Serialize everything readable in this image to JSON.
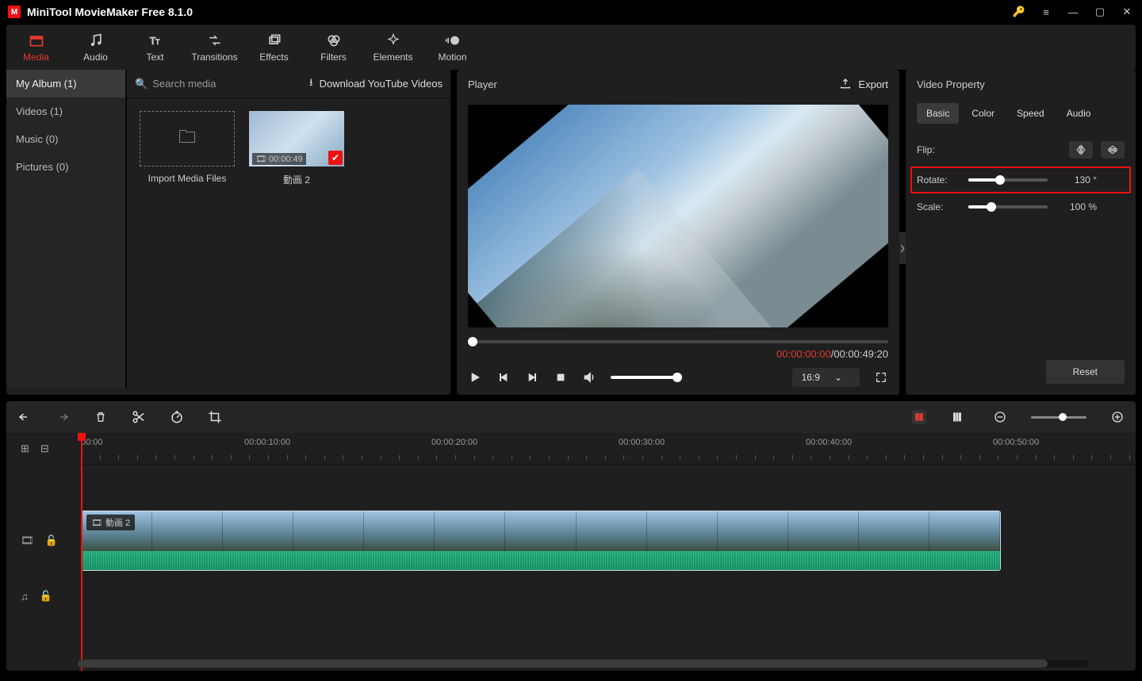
{
  "app": {
    "title": "MiniTool MovieMaker Free 8.1.0"
  },
  "ribbon": [
    {
      "id": "media",
      "label": "Media",
      "active": true
    },
    {
      "id": "audio",
      "label": "Audio"
    },
    {
      "id": "text",
      "label": "Text"
    },
    {
      "id": "transitions",
      "label": "Transitions"
    },
    {
      "id": "effects",
      "label": "Effects"
    },
    {
      "id": "filters",
      "label": "Filters"
    },
    {
      "id": "elements",
      "label": "Elements"
    },
    {
      "id": "motion",
      "label": "Motion"
    }
  ],
  "media": {
    "sidebar": [
      {
        "label": "My Album (1)",
        "active": true
      },
      {
        "label": "Videos (1)"
      },
      {
        "label": "Music (0)"
      },
      {
        "label": "Pictures (0)"
      }
    ],
    "search_placeholder": "Search media",
    "download_label": "Download YouTube Videos",
    "import_label": "Import Media Files",
    "clip": {
      "name": "動画 2",
      "duration": "00:00:49"
    }
  },
  "player": {
    "title": "Player",
    "export_label": "Export",
    "current_time": "00:00:00:00",
    "total_time": "00:00:49:20",
    "time_sep": " / ",
    "aspect": "16:9"
  },
  "props": {
    "title": "Video Property",
    "tabs": [
      {
        "label": "Basic",
        "active": true
      },
      {
        "label": "Color"
      },
      {
        "label": "Speed"
      },
      {
        "label": "Audio"
      }
    ],
    "flip_label": "Flip:",
    "rotate_label": "Rotate:",
    "rotate_value": "130 °",
    "rotate_pct": 36,
    "scale_label": "Scale:",
    "scale_value": "100 %",
    "scale_pct": 25,
    "reset_label": "Reset"
  },
  "timeline": {
    "ruler": [
      "00:00",
      "00:00:10:00",
      "00:00:20:00",
      "00:00:30:00",
      "00:00:40:00",
      "00:00:50:00"
    ],
    "clip_label": "動画 2"
  }
}
